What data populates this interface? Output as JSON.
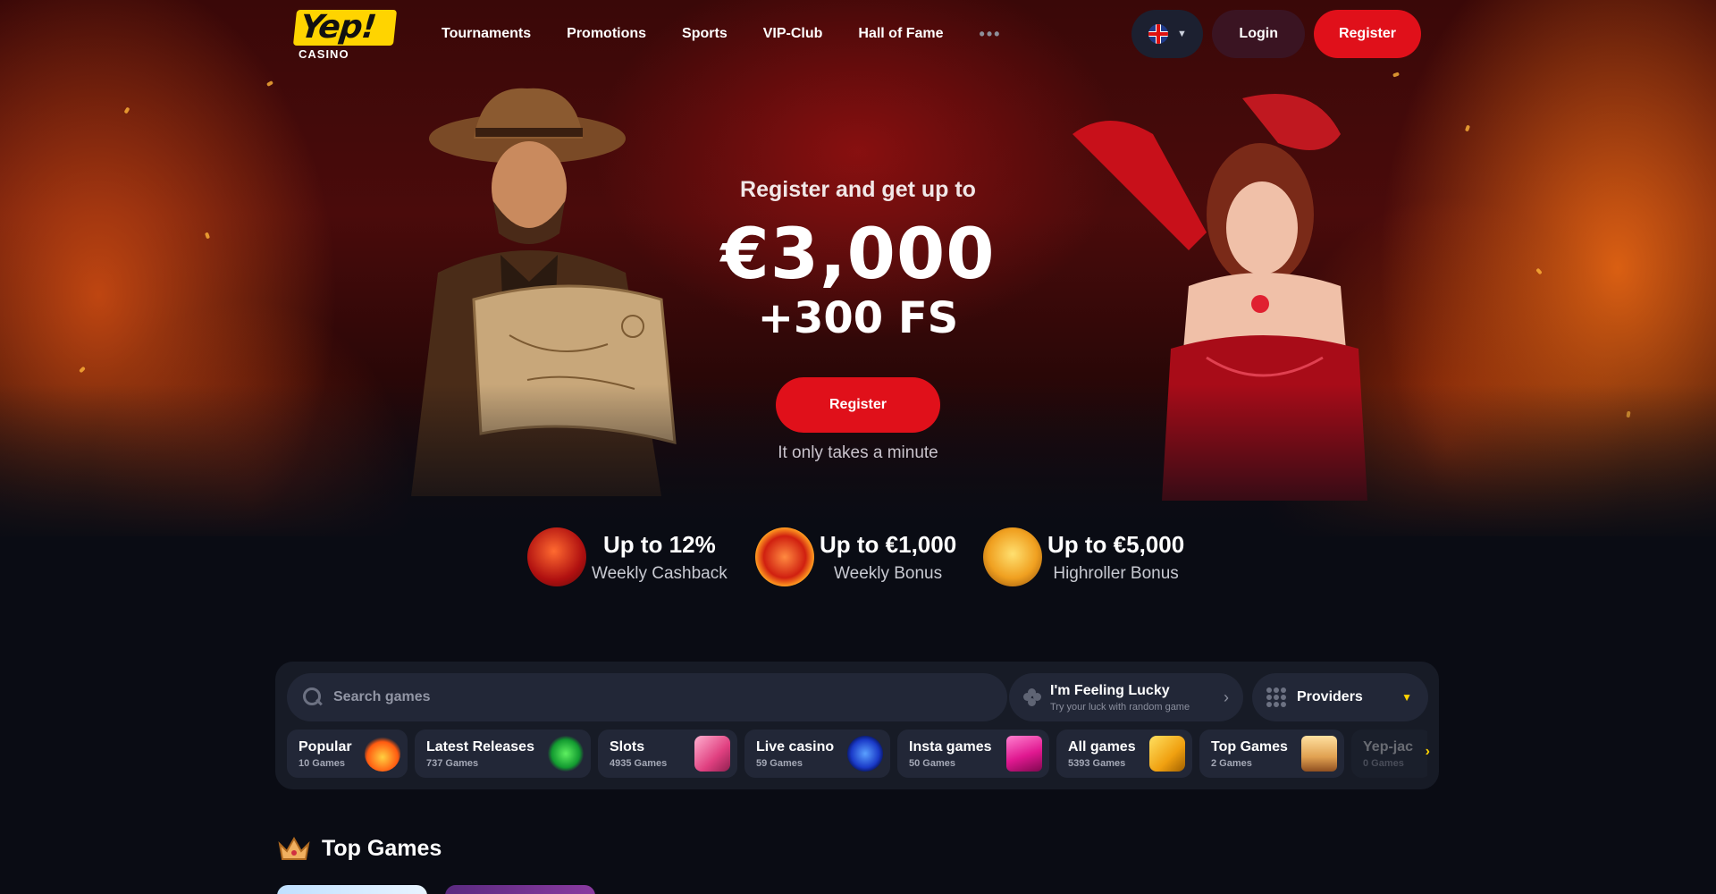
{
  "header": {
    "logo_text": "Yep!",
    "logo_sub": "CASINO",
    "nav": [
      {
        "label": "Tournaments"
      },
      {
        "label": "Promotions"
      },
      {
        "label": "Sports"
      },
      {
        "label": "VIP-Club"
      },
      {
        "label": "Hall of Fame"
      }
    ],
    "more_label": "•••",
    "language_icon": "uk-flag-icon",
    "login_label": "Login",
    "register_label": "Register"
  },
  "hero": {
    "subtitle": "Register and get up to",
    "amount": "€3,000",
    "free_spins": "+300 FS",
    "register_label": "Register",
    "note": "It only takes a minute"
  },
  "bonuses": [
    {
      "title": "Up to 12%",
      "subtitle": "Weekly Cashback",
      "icon": "cashback-icon"
    },
    {
      "title": "Up to €1,000",
      "subtitle": "Weekly Bonus",
      "icon": "calendar-bonus-icon"
    },
    {
      "title": "Up to €5,000",
      "subtitle": "Highroller Bonus",
      "icon": "money-bag-icon"
    }
  ],
  "games_panel": {
    "search_placeholder": "Search games",
    "lucky_title": "I'm Feeling Lucky",
    "lucky_subtitle": "Try your luck with random game",
    "providers_label": "Providers",
    "categories": [
      {
        "name": "Popular",
        "count": "10 Games",
        "icon": "fire-icon"
      },
      {
        "name": "Latest Releases",
        "count": "737 Games",
        "icon": "clover-icon"
      },
      {
        "name": "Slots",
        "count": "4935 Games",
        "icon": "slot-machine-icon"
      },
      {
        "name": "Live casino",
        "count": "59 Games",
        "icon": "poker-chip-icon"
      },
      {
        "name": "Insta games",
        "count": "50 Games",
        "icon": "lightning-icon"
      },
      {
        "name": "All games",
        "count": "5393 Games",
        "icon": "dice-icon"
      },
      {
        "name": "Top Games",
        "count": "2 Games",
        "icon": "crown-icon"
      },
      {
        "name": "Yep-jac",
        "count": "0 Games",
        "icon": "jackpot-icon"
      }
    ]
  },
  "top_games": {
    "title": "Top Games"
  },
  "colors": {
    "accent_red": "#e0101a",
    "brand_yellow": "#ffd400",
    "panel_bg": "#171b26",
    "page_bg": "#0a0c14"
  }
}
